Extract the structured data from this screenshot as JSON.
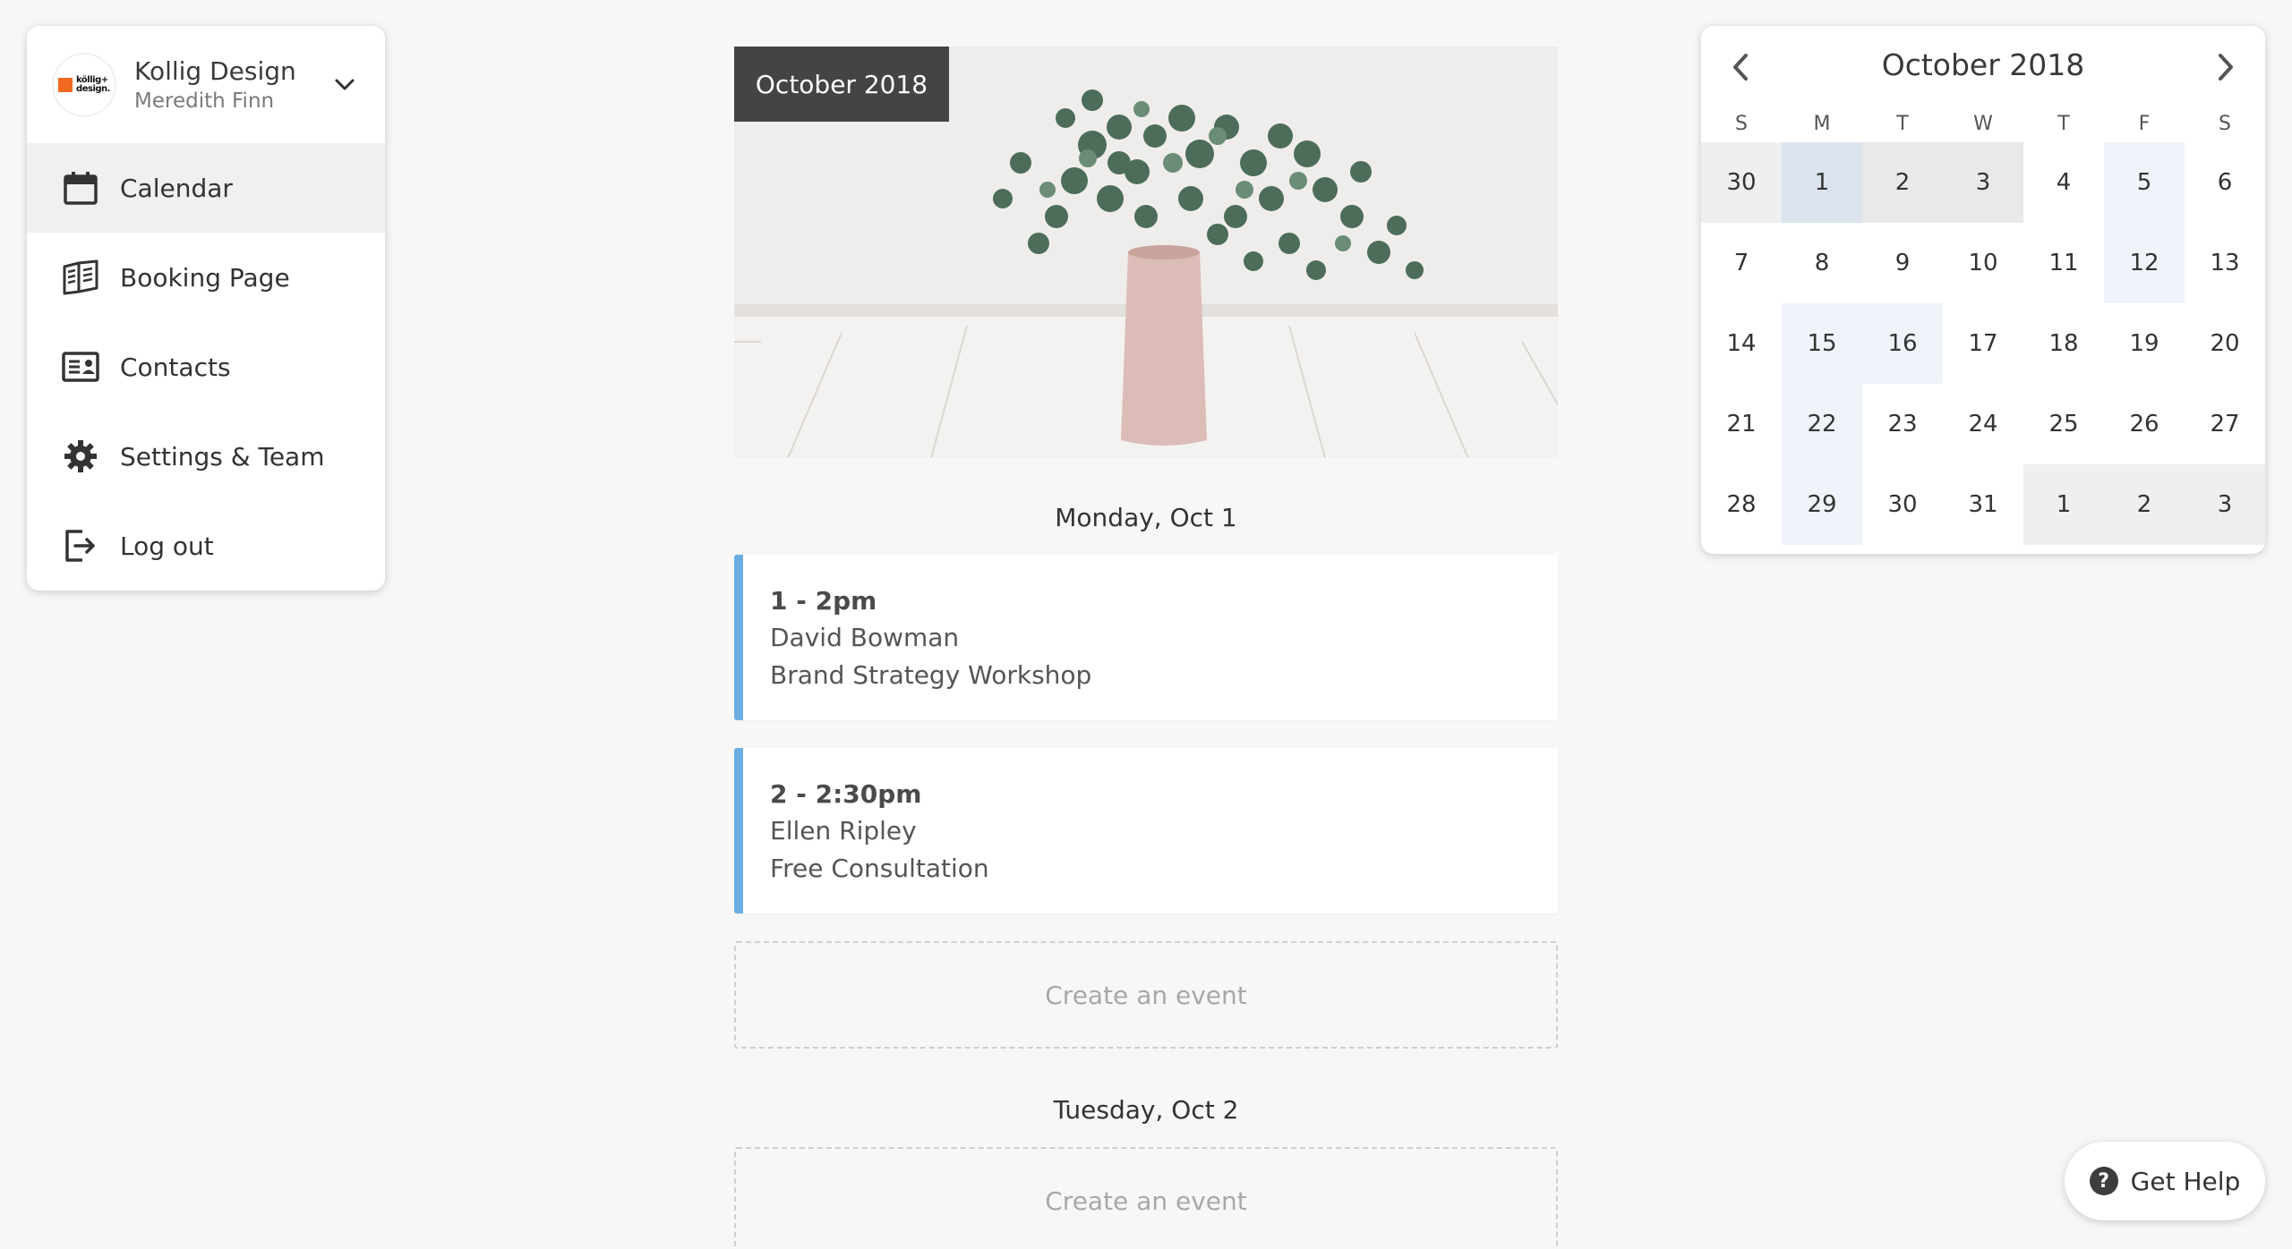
{
  "account": {
    "logo_text": "kollig+ design.",
    "name": "Kollig Design",
    "user": "Meredith Finn"
  },
  "nav": [
    {
      "label": "Calendar",
      "icon": "calendar-icon",
      "active": true
    },
    {
      "label": "Booking Page",
      "icon": "book-icon",
      "active": false
    },
    {
      "label": "Contacts",
      "icon": "contact-card-icon",
      "active": false
    },
    {
      "label": "Settings & Team",
      "icon": "gear-icon",
      "active": false
    },
    {
      "label": "Log out",
      "icon": "logout-icon",
      "active": false
    }
  ],
  "hero": {
    "badge": "October 2018"
  },
  "days": [
    {
      "heading": "Monday, Oct 1",
      "events": [
        {
          "time": "1 - 2pm",
          "person": "David Bowman",
          "title": "Brand Strategy Workshop"
        },
        {
          "time": "2 - 2:30pm",
          "person": "Ellen Ripley",
          "title": "Free Consultation"
        }
      ],
      "create_label": "Create an event"
    },
    {
      "heading": "Tuesday, Oct 2",
      "events": [],
      "create_label": "Create an event"
    }
  ],
  "mini_calendar": {
    "title": "October 2018",
    "weekdays": [
      "S",
      "M",
      "T",
      "W",
      "T",
      "F",
      "S"
    ],
    "weeks": [
      [
        "30",
        "1",
        "2",
        "3",
        "4",
        "5",
        "6"
      ],
      [
        "7",
        "8",
        "9",
        "10",
        "11",
        "12",
        "13"
      ],
      [
        "14",
        "15",
        "16",
        "17",
        "18",
        "19",
        "20"
      ],
      [
        "21",
        "22",
        "23",
        "24",
        "25",
        "26",
        "27"
      ],
      [
        "28",
        "29",
        "30",
        "31",
        "1",
        "2",
        "3"
      ]
    ],
    "colors": {
      "outside_month": "#efefef",
      "selected": "#dbe4ee",
      "selected_range": "#e9e9e9",
      "has_events": "#eef4fa"
    }
  },
  "help": {
    "label": "Get Help",
    "icon": "question-icon"
  },
  "colors": {
    "event_accent": "#6aaee3",
    "background": "#f7f7f7"
  }
}
